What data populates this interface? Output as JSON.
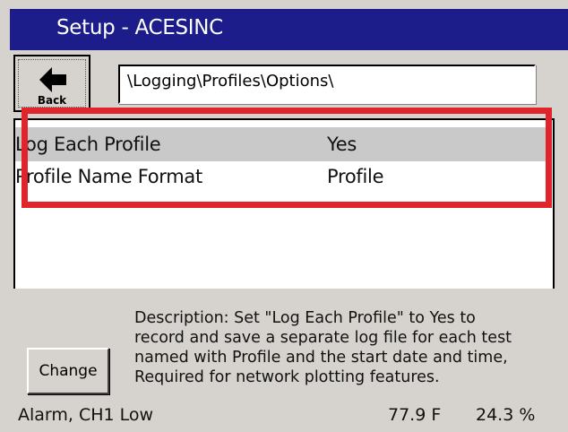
{
  "window": {
    "title": "Setup - ACESINC"
  },
  "toolbar": {
    "back_label": "Back",
    "back_icon": "left-arrow-icon"
  },
  "path": {
    "value": "\\Logging\\Profiles\\Options\\"
  },
  "settings": [
    {
      "name": "Log Each Profile",
      "value": "Yes",
      "selected": true
    },
    {
      "name": "Profile Name Format",
      "value": "Profile",
      "selected": false
    }
  ],
  "actions": {
    "change_label": "Change"
  },
  "description": {
    "lines": [
      "Description:  Set \"Log Each Profile\" to Yes to",
      "record and save a separate log file for each test",
      "named with Profile and the start date and time,",
      "Required for network plotting features."
    ]
  },
  "status": {
    "alarm": "Alarm, CH1 Low",
    "temperature": "77.9 F",
    "humidity": "24.3 %"
  },
  "colors": {
    "title_bar": "#1c1c8a",
    "highlight_box": "#e0242b",
    "selected_row": "#c9c9c9",
    "background": "#d6d3ce"
  }
}
